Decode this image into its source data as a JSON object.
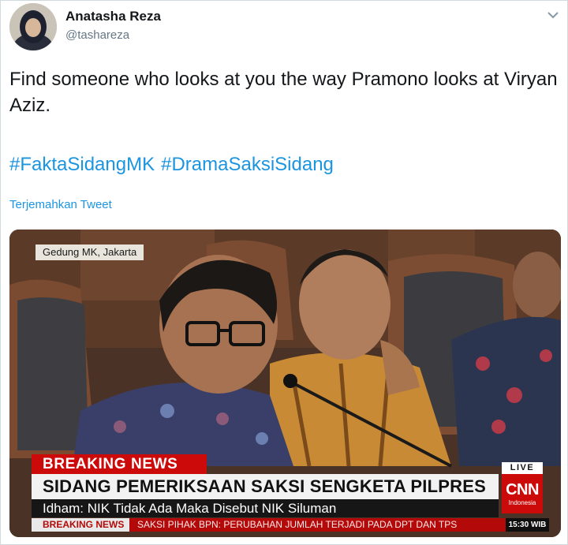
{
  "tweet": {
    "author_name": "Anatasha Reza",
    "author_handle": "@tashareza",
    "text": "Find someone who looks at you the way Pramono looks at Viryan Aziz.",
    "hashtags": [
      "#FaktaSidangMK",
      "#DramaSaksiSidang"
    ],
    "translate_label": "Terjemahkan Tweet"
  },
  "icons": {
    "avatar": "profile-avatar",
    "menu": "chevron-down-icon"
  },
  "media": {
    "location_tag": "Gedung MK, Jakarta",
    "breaking_label": "BREAKING NEWS",
    "headline": "SIDANG PEMERIKSAAN SAKSI SENGKETA PILPRES",
    "subline": "Idham: NIK Tidak Ada Maka Disebut NIK Siluman",
    "live_label": "LIVE",
    "network_logo": "CNN",
    "network_region": "Indonesia",
    "ticker_label": "BREAKING NEWS",
    "ticker_text": "SAKSI PIHAK BPN: PERUBAHAN JUMLAH TERJADI PADA DPT DAN TPS",
    "ticker_time": "15:30 WIB"
  },
  "colors": {
    "link": "#1b95e0",
    "breaking_red": "#cc0a0a",
    "secondary_text": "#657786"
  }
}
